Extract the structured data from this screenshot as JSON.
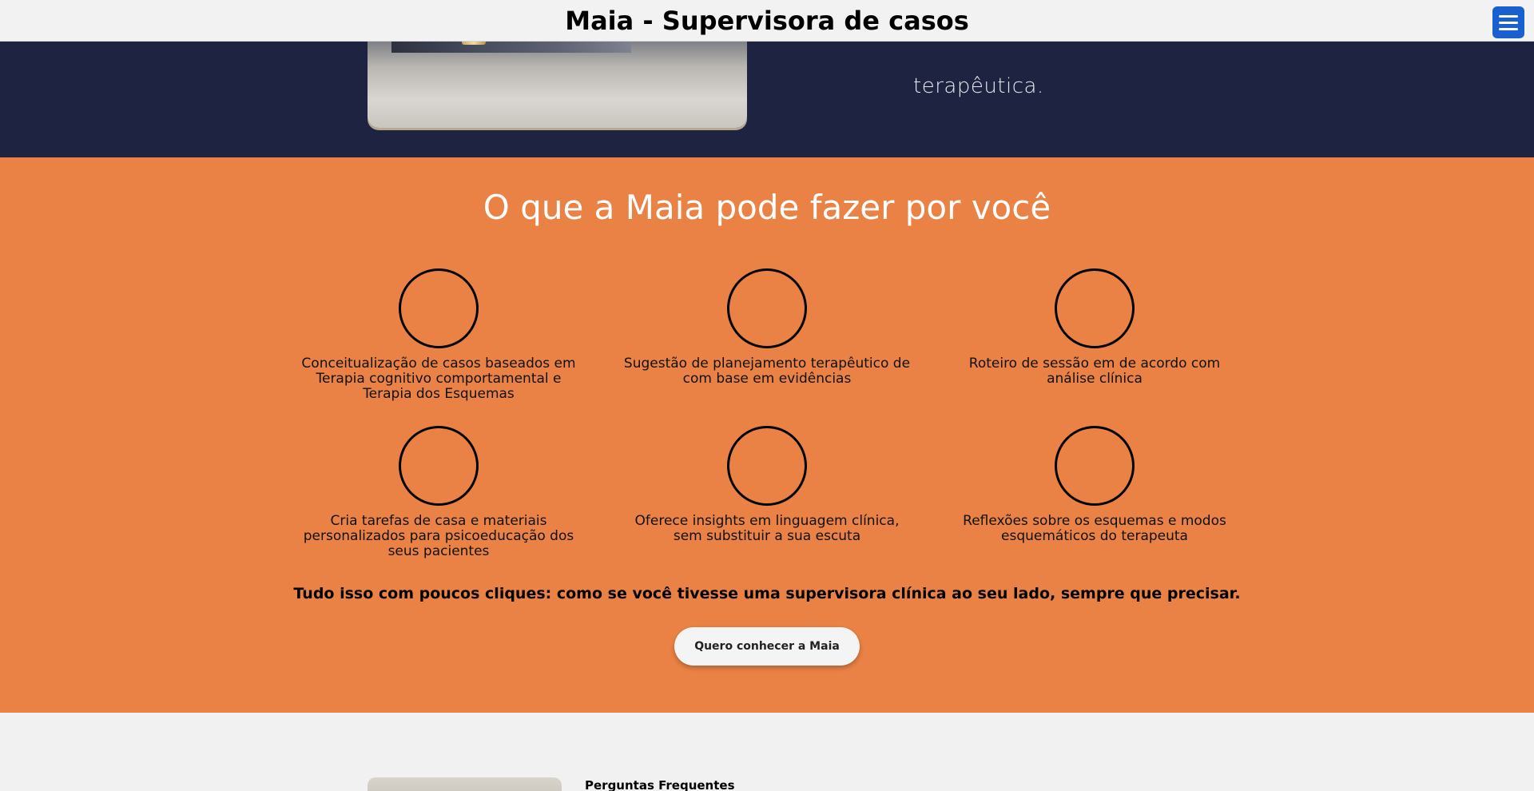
{
  "header": {
    "title": "Maia - Supervisora de casos",
    "menu_icon": "hamburger-menu-icon",
    "menu_color": "#1a5fd0"
  },
  "hero": {
    "text_fragment": "terapêutica.",
    "background_color": "#1d2340"
  },
  "features": {
    "title": "O que a Maia pode fazer por você",
    "background_color": "#e98244",
    "items": [
      {
        "icon": "circle-icon",
        "text": "Conceitualização de casos baseados em Terapia cognitivo comportamental e Terapia dos Esquemas"
      },
      {
        "icon": "circle-icon",
        "text": "Sugestão de planejamento terapêutico de com base em evidências"
      },
      {
        "icon": "circle-icon",
        "text": "Roteiro de sessão em de acordo com análise clínica"
      },
      {
        "icon": "circle-icon",
        "text": "Cria tarefas de casa e materiais personalizados para psicoeducação dos seus pacientes"
      },
      {
        "icon": "circle-icon",
        "text": "Oferece insights em linguagem clínica, sem substituir a sua escuta"
      },
      {
        "icon": "circle-icon",
        "text": "Reflexões sobre os esquemas e modos esquemáticos do terapeuta"
      }
    ],
    "tagline": "Tudo isso com poucos cliques: como se você tivesse uma supervisora clínica ao seu lado, sempre que precisar.",
    "cta_label": "Quero conhecer a Maia"
  },
  "faq": {
    "title": "Perguntas Frequentes"
  }
}
